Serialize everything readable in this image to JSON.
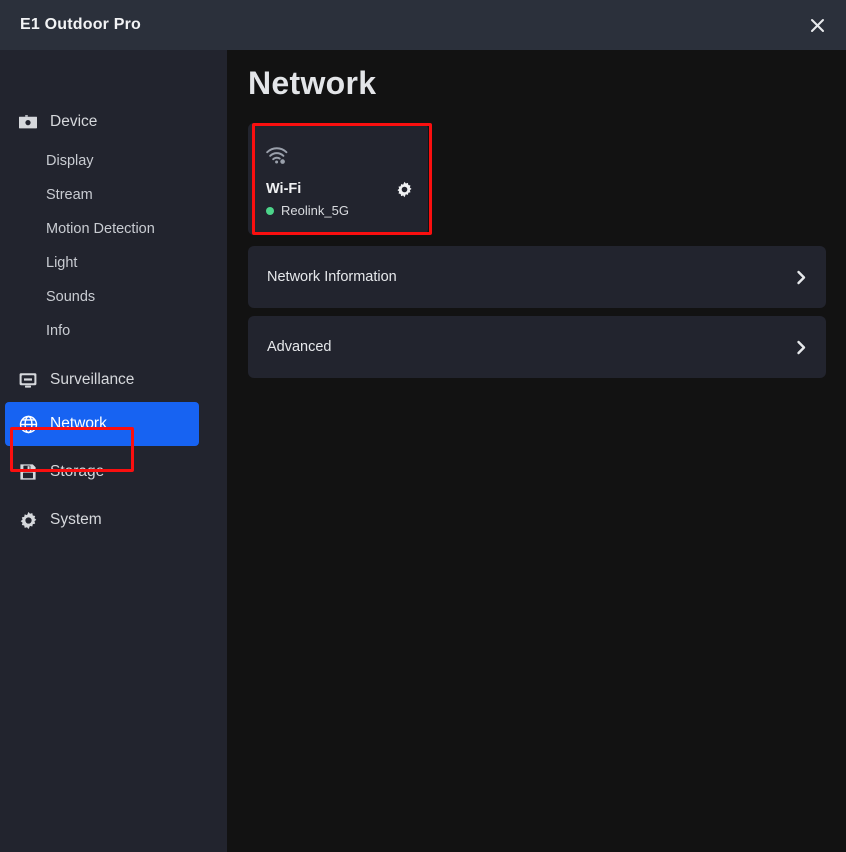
{
  "window": {
    "title": "E1 Outdoor Pro",
    "close_icon": "close-icon"
  },
  "sidebar": {
    "items": [
      {
        "label": "Device",
        "icon": "camera-icon",
        "type": "group",
        "selected": false
      },
      {
        "label": "Display",
        "type": "sub",
        "selected": false
      },
      {
        "label": "Stream",
        "type": "sub",
        "selected": false
      },
      {
        "label": "Motion Detection",
        "type": "sub",
        "selected": false
      },
      {
        "label": "Light",
        "type": "sub",
        "selected": false
      },
      {
        "label": "Sounds",
        "type": "sub",
        "selected": false
      },
      {
        "label": "Info",
        "type": "sub",
        "selected": false
      },
      {
        "label": "Surveillance",
        "icon": "monitor-icon",
        "type": "group",
        "selected": false
      },
      {
        "label": "Network",
        "icon": "globe-icon",
        "type": "group",
        "selected": true
      },
      {
        "label": "Storage",
        "icon": "floppy-disk-icon",
        "type": "group",
        "selected": false
      },
      {
        "label": "System",
        "icon": "gear-icon",
        "type": "group",
        "selected": false
      }
    ],
    "selected_label": "Network"
  },
  "main": {
    "page_title": "Network",
    "wifi_card": {
      "wifi_icon": "wifi-icon",
      "title": "Wi-Fi",
      "ssid": "Reolink_5G",
      "status_color": "#4cd48a",
      "settings_icon": "gear-icon"
    },
    "rows": [
      {
        "label": "Network Information",
        "chevron": "chevron-right-icon"
      },
      {
        "label": "Advanced",
        "chevron": "chevron-right-icon"
      }
    ]
  },
  "annotations": {
    "color": "#fa0f0f",
    "boxes": [
      {
        "target": "wifi-card"
      },
      {
        "target": "sidebar-item-network"
      }
    ]
  },
  "colors": {
    "titlebar_bg": "#2b303b",
    "sidebar_bg": "#22242e",
    "main_bg": "#121212",
    "card_bg": "#22242e",
    "accent_blue": "#1763f2",
    "status_green": "#4cd48a",
    "annotation_red": "#fa0f0f"
  }
}
